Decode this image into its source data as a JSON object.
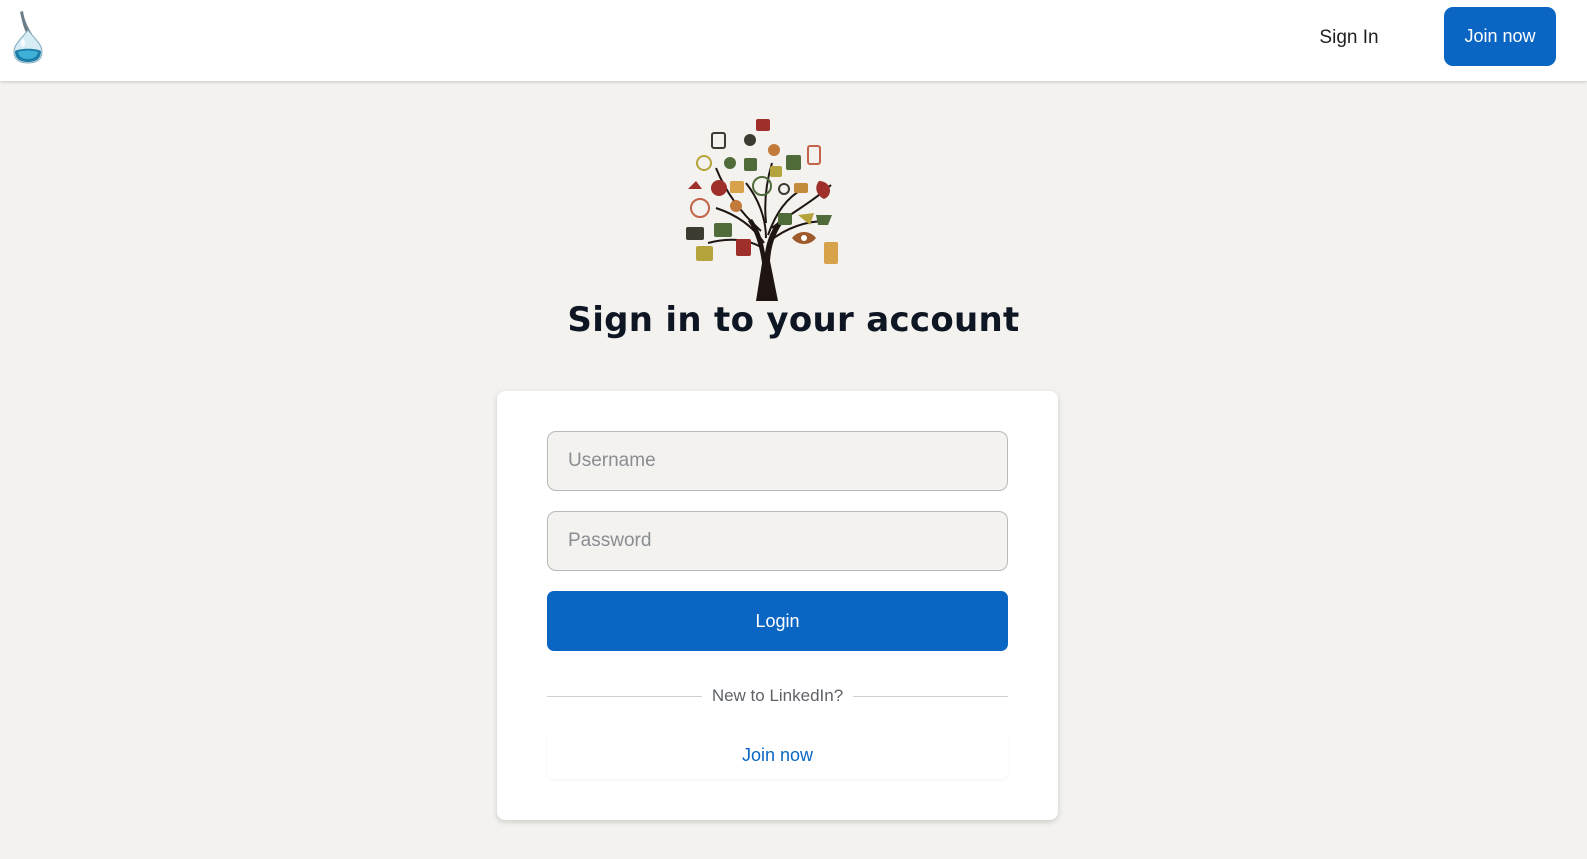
{
  "header": {
    "logo_icon": "water-drop-flask-logo-icon",
    "sign_in_label": "Sign In",
    "join_now_label": "Join now"
  },
  "hero": {
    "image_icon": "social-media-tree-illustration",
    "title": "Sign in to your account"
  },
  "form": {
    "username_placeholder": "Username",
    "username_value": "",
    "password_placeholder": "Password",
    "password_value": "",
    "login_label": "Login",
    "divider_text": "New to LinkedIn?",
    "join_now_label": "Join now"
  },
  "colors": {
    "primary": "#0a66c2",
    "page_background": "#f3f2ef",
    "title_text": "#0f1623"
  }
}
